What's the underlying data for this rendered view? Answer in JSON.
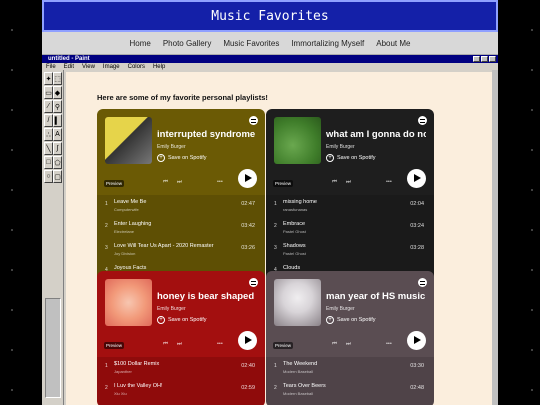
{
  "site": {
    "title": "Music Favorites",
    "nav": [
      "Home",
      "Photo Gallery",
      "Music Favorites",
      "Immortalizing Myself",
      "About Me"
    ]
  },
  "paint": {
    "title": "untitled - Paint",
    "menu": [
      "File",
      "Edit",
      "View",
      "Image",
      "Colors",
      "Help"
    ]
  },
  "intro_text": "Here are some of my favorite personal playlists!",
  "common": {
    "save_label": "Save on Spotify",
    "preview_label": "Preview"
  },
  "playlists": [
    {
      "title": "interrupted syndrome",
      "artist": "Emily Burger",
      "color": "#6b5a05",
      "tracks_color": "#5e4f04",
      "tracks": [
        {
          "num": "1",
          "name": "Leave Me Be",
          "artist": "Computerwife",
          "duration": "02:47"
        },
        {
          "num": "2",
          "name": "Enter Laughing",
          "artist": "Electrelane",
          "duration": "03:42"
        },
        {
          "num": "3",
          "name": "Love Will Tear Us Apart - 2020 Remaster",
          "artist": "Joy Division",
          "duration": "03:26"
        },
        {
          "num": "4",
          "name": "Joyous Facts",
          "artist": "",
          "duration": ""
        }
      ]
    },
    {
      "title": "what am I gonna do now",
      "artist": "Emily Burger",
      "color": "#1e1e1e",
      "tracks_color": "#1a1a1a",
      "tracks": [
        {
          "num": "1",
          "name": "missing home",
          "artist": "ranasfunanas",
          "duration": "02:04"
        },
        {
          "num": "2",
          "name": "Embrace",
          "artist": "Pastel Ghost",
          "duration": "03:24"
        },
        {
          "num": "3",
          "name": "Shadows",
          "artist": "Pastel Ghost",
          "duration": "03:28"
        },
        {
          "num": "4",
          "name": "Clouds",
          "artist": "",
          "duration": ""
        }
      ]
    },
    {
      "title": "honey is bear shaped",
      "artist": "Emily Burger",
      "color": "#a30f0f",
      "tracks_color": "#8f0b0b",
      "tracks": [
        {
          "num": "1",
          "name": "$100 Dollar Remix",
          "artist": "Japanther",
          "duration": "02:40"
        },
        {
          "num": "2",
          "name": "I Luv the Valley OH!",
          "artist": "Xiu Xiu",
          "duration": "02:59"
        }
      ]
    },
    {
      "title": "man year of HS music",
      "artist": "Emily Burger",
      "color": "#5a4d52",
      "tracks_color": "#4f4348",
      "tracks": [
        {
          "num": "1",
          "name": "The Weekend",
          "artist": "Modern Baseball",
          "duration": "03:30"
        },
        {
          "num": "2",
          "name": "Tears Over Beers",
          "artist": "Modern Baseball",
          "duration": "02:48"
        }
      ]
    }
  ]
}
